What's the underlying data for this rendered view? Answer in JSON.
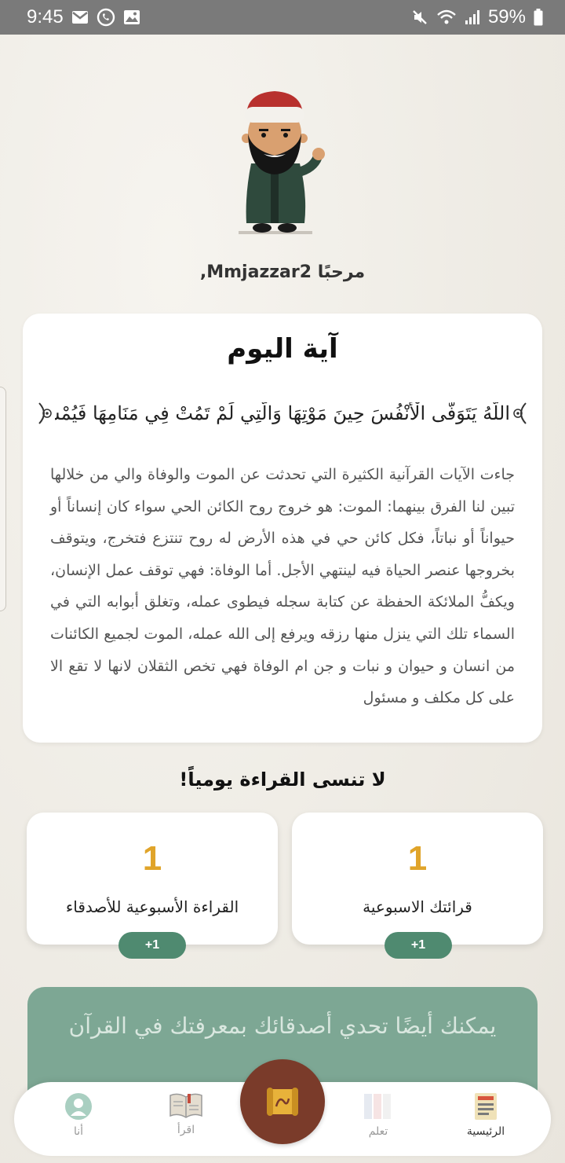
{
  "status_bar": {
    "time": "9:45",
    "battery": "59%",
    "left_icons": [
      "gmail-icon",
      "whatsapp-icon",
      "gallery-icon"
    ],
    "right_icons": [
      "mute-icon",
      "wifi-icon",
      "signal-icon",
      "battery-icon"
    ]
  },
  "greeting": "مرحبًا Mmjazzar2,",
  "ayah_card": {
    "title": "آية اليوم",
    "ayah": "اللَّهُ يَتَوَفَّى الْأَنْفُسَ حِينَ مَوْتِهَا وَالَّتِي لَمْ تَمُتْ فِي مَنَامِهَا فَيُمْسِكُ الَّتِي",
    "tafsir": "جاءت الآيات القرآنية الكثيرة التي تحدثت عن الموت والوفاة والي من خلالها تبين لنا الفرق بينهما: الموت: هو خروج روح الكائن الحي سواء كان إنساناً أو حيواناً أو نباتاً، فكل كائن حي في هذه الأرض له روح تنتزع فتخرج، ويتوقف بخروجها عنصر الحياة فيه لينتهي الأجل. أما الوفاة: فهي توقف عمل الإنسان، ويكفُّ الملائكة الحفظة عن كتابة سجله فيطوى عمله، وتغلق أبوابه التي في السماء تلك التي ينزل منها رزقه ويرفع إلى الله عمله، الموت لجميع الكائنات من انسان و حيوان و نبات و جن ام الوفاة فهي تخص الثقلان لانها لا تقع الا على كل مكلف و مسئول"
  },
  "reminder": "لا تنسى القراءة يومياً!",
  "stats": {
    "weekly": {
      "value": "1",
      "label": "قرائتك الاسبوعية",
      "button": "+1"
    },
    "friends": {
      "value": "1",
      "label": "القراءة الأسبوعية للأصدقاء",
      "button": "+1"
    }
  },
  "challenge": {
    "text": "يمكنك أيضًا تحدي أصدقائك بمعرفتك في القرآن"
  },
  "bottom_nav": {
    "home": "الرئيسية",
    "learn": "تعلم",
    "read": "اقرأ",
    "me": "أنا"
  },
  "colors": {
    "accent_gold": "#e0a42a",
    "pill_green": "#4f8a70",
    "challenge_green": "#7da794",
    "fab_brown": "#7a3b2a"
  }
}
